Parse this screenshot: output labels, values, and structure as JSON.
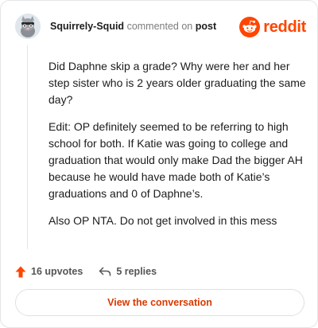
{
  "header": {
    "username": "Squirrely-Squid",
    "commented_on": "commented on",
    "post_link": "post",
    "brand_word": "reddit",
    "avatar_icon": "squirrel-avatar-icon",
    "brand_icon": "reddit-snoo-icon"
  },
  "comment": {
    "paragraphs": [
      "Did Daphne skip a grade? Why were her and her step sister who is 2 years older graduating the same day?",
      "Edit: OP definitely seemed to be referring to high school for both. If Katie was going to college and graduation that would only make Dad the bigger AH because he would have made both of Katie’s graduations and 0 of Daphne’s.",
      "Also OP NTA. Do not get involved in this mess"
    ]
  },
  "actions": {
    "upvotes": "16 upvotes",
    "replies": "5 replies",
    "upvote_icon": "upvote-arrow-icon",
    "reply_icon": "reply-arrow-icon"
  },
  "cta": {
    "label": "View the conversation"
  },
  "colors": {
    "accent": "#ff4500",
    "cta_text": "#d93a00",
    "border": "#e5e5e5"
  }
}
